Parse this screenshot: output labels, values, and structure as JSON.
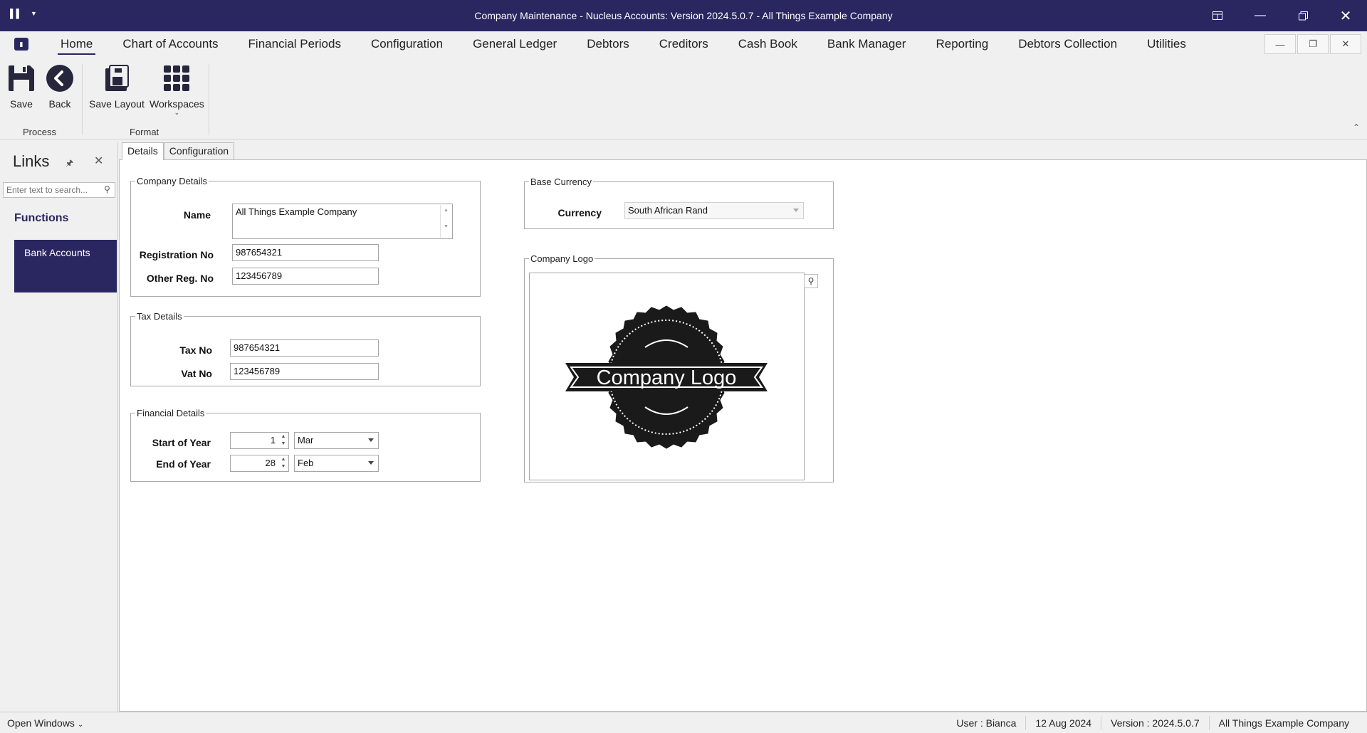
{
  "window": {
    "title": "Company Maintenance - Nucleus Accounts: Version 2024.5.0.7 - All Things Example Company"
  },
  "menu": {
    "tabs": [
      "Home",
      "Chart of Accounts",
      "Financial Periods",
      "Configuration",
      "General Ledger",
      "Debtors",
      "Creditors",
      "Cash Book",
      "Bank Manager",
      "Reporting",
      "Debtors Collection",
      "Utilities"
    ]
  },
  "ribbon": {
    "save_label": "Save",
    "back_label": "Back",
    "save_layout_label": "Save Layout",
    "workspaces_label": "Workspaces",
    "group_process": "Process",
    "group_format": "Format"
  },
  "links": {
    "title": "Links",
    "search_placeholder": "Enter text to search...",
    "functions_label": "Functions",
    "items": [
      "Bank Accounts"
    ]
  },
  "content_tabs": [
    "Details",
    "Configuration"
  ],
  "company_details": {
    "legend": "Company Details",
    "name_label": "Name",
    "name_value": "All Things Example Company",
    "reg_label": "Registration No",
    "reg_value": "987654321",
    "other_reg_label": "Other Reg. No",
    "other_reg_value": "123456789"
  },
  "tax_details": {
    "legend": "Tax Details",
    "tax_label": "Tax No",
    "tax_value": "987654321",
    "vat_label": "Vat No",
    "vat_value": "123456789"
  },
  "financial_details": {
    "legend": "Financial Details",
    "start_label": "Start of Year",
    "start_day": "1",
    "start_month": "Mar",
    "end_label": "End of Year",
    "end_day": "28",
    "end_month": "Feb"
  },
  "base_currency": {
    "legend": "Base Currency",
    "currency_label": "Currency",
    "currency_value": "South African Rand"
  },
  "company_logo": {
    "legend": "Company Logo",
    "logo_text": "Company Logo"
  },
  "status": {
    "open_windows": "Open Windows",
    "user": "User : Bianca",
    "date": "12 Aug 2024",
    "version": "Version : 2024.5.0.7",
    "company": "All Things Example Company"
  },
  "colors": {
    "brand": "#292660"
  }
}
